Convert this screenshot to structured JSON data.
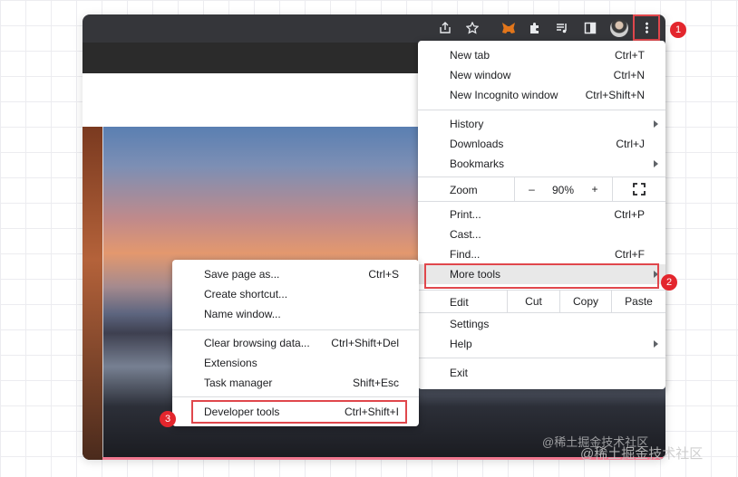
{
  "menu": {
    "section1": [
      {
        "label": "New tab",
        "shortcut": "Ctrl+T"
      },
      {
        "label": "New window",
        "shortcut": "Ctrl+N"
      },
      {
        "label": "New Incognito window",
        "shortcut": "Ctrl+Shift+N"
      }
    ],
    "section2": [
      {
        "label": "History",
        "shortcut": ""
      },
      {
        "label": "Downloads",
        "shortcut": "Ctrl+J"
      },
      {
        "label": "Bookmarks",
        "shortcut": ""
      }
    ],
    "zoom": {
      "label": "Zoom",
      "minus": "–",
      "level": "90%",
      "plus": "+"
    },
    "section3": [
      {
        "label": "Print...",
        "shortcut": "Ctrl+P"
      },
      {
        "label": "Cast...",
        "shortcut": ""
      },
      {
        "label": "Find...",
        "shortcut": "Ctrl+F"
      },
      {
        "label": "More tools",
        "shortcut": ""
      }
    ],
    "edit": {
      "label": "Edit",
      "cut": "Cut",
      "copy": "Copy",
      "paste": "Paste"
    },
    "section4": [
      {
        "label": "Settings",
        "shortcut": ""
      },
      {
        "label": "Help",
        "shortcut": ""
      }
    ],
    "exit": "Exit"
  },
  "submenu": {
    "section1": [
      {
        "label": "Save page as...",
        "shortcut": "Ctrl+S"
      },
      {
        "label": "Create shortcut...",
        "shortcut": ""
      },
      {
        "label": "Name window...",
        "shortcut": ""
      }
    ],
    "section2": [
      {
        "label": "Clear browsing data...",
        "shortcut": "Ctrl+Shift+Del"
      },
      {
        "label": "Extensions",
        "shortcut": ""
      },
      {
        "label": "Task manager",
        "shortcut": "Shift+Esc"
      }
    ],
    "developer": {
      "label": "Developer tools",
      "shortcut": "Ctrl+Shift+I"
    }
  },
  "badges": [
    "1",
    "2",
    "3"
  ],
  "watermark": "@稀土掘金技术社区",
  "icons": {
    "share": "share-icon",
    "star": "star-icon",
    "fox": "metamask-fox-icon",
    "puzzle": "extensions-puzzle-icon",
    "media": "media-queue-icon",
    "sidepanel": "side-panel-icon",
    "menu": "three-dot-menu-icon"
  },
  "colors": {
    "highlight": "#e0474c",
    "badge": "#e3262d",
    "toolbar": "#35363a"
  }
}
